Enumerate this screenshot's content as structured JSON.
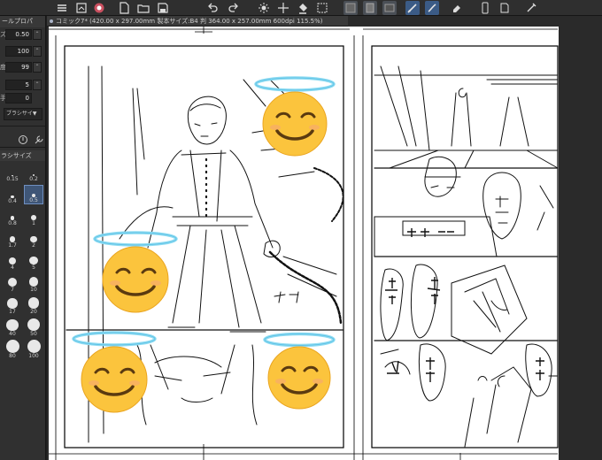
{
  "document_tab": {
    "title": "コミック7* (420.00 x 297.00mm 製本サイズ:B4 判 364.00 x 257.00mm 600dpi 115.5%)"
  },
  "left_panel": {
    "tab_label": "ールプロパ",
    "props": [
      {
        "label": "ズ",
        "value": "0.50"
      },
      {
        "label": "",
        "value": "100"
      },
      {
        "label": "度",
        "value": "99"
      },
      {
        "label": "",
        "value": "5"
      },
      {
        "label": "手",
        "value": "0"
      }
    ],
    "brush_shape": "ブラシサイ▼",
    "brush_size_header": "ラシサイズ",
    "sizes": [
      "0.15",
      "0.2",
      "0.4",
      "0.5",
      "0.8",
      "1",
      "1.7",
      "2",
      "4",
      "5",
      "7",
      "10",
      "17",
      "20",
      "40",
      "50",
      "80",
      "100"
    ],
    "selected_size": "0.5"
  },
  "icons": {
    "toolbar": [
      "menu-icon",
      "layer-icon",
      "clip-studio-icon",
      "new-icon",
      "open-icon",
      "save-icon",
      "undo-icon",
      "redo-icon",
      "sun-icon",
      "cross-icon",
      "fill-icon",
      "transform-icon",
      "ruler-icon",
      "pen-icon",
      "brush-icon",
      "eraser-icon",
      "phone-icon",
      "doc-icon",
      "pen2-icon"
    ],
    "panel": [
      "settings-icon",
      "wrench-icon"
    ]
  },
  "emoji_stickers": [
    "😊",
    "😊",
    "😊",
    "😊"
  ],
  "colors": {
    "toolbar_bg": "#2f2f2f",
    "panel_bg": "#303030",
    "selection_blue": "#3f5677",
    "halo": "#7fd6f0"
  }
}
